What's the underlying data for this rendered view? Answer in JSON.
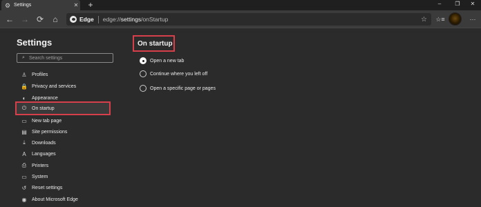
{
  "tab": {
    "title": "Settings",
    "icon": "gear-icon",
    "close_icon": "close-icon"
  },
  "tabstrip": {
    "new_tab": "+"
  },
  "window": {
    "minimize": "–",
    "restore": "❐",
    "close": "✕"
  },
  "toolbar": {
    "back": "←",
    "forward": "→",
    "refresh": "⟳",
    "home": "⌂",
    "address_label": "Edge",
    "url_prefix": "edge://",
    "url_bold": "settings",
    "url_suffix": "/onStartup",
    "favorite_icon": "☆",
    "collections_icon": "☆≡",
    "more_icon": "···"
  },
  "sidebar": {
    "title": "Settings",
    "search_placeholder": "Search settings",
    "items": [
      {
        "label": "Profiles",
        "icon": "person-icon",
        "glyph": "♙"
      },
      {
        "label": "Privacy and services",
        "icon": "lock-icon",
        "glyph": "🔒"
      },
      {
        "label": "Appearance",
        "icon": "palette-icon",
        "glyph": "◐"
      },
      {
        "label": "On startup",
        "icon": "power-icon",
        "glyph": "⏻"
      },
      {
        "label": "New tab page",
        "icon": "newtab-icon",
        "glyph": "▭"
      },
      {
        "label": "Site permissions",
        "icon": "permissions-icon",
        "glyph": "▤"
      },
      {
        "label": "Downloads",
        "icon": "download-icon",
        "glyph": "⤓"
      },
      {
        "label": "Languages",
        "icon": "language-icon",
        "glyph": "A"
      },
      {
        "label": "Printers",
        "icon": "printer-icon",
        "glyph": "⎙"
      },
      {
        "label": "System",
        "icon": "system-icon",
        "glyph": "▭"
      },
      {
        "label": "Reset settings",
        "icon": "reset-icon",
        "glyph": "↺"
      },
      {
        "label": "About Microsoft Edge",
        "icon": "edge-icon",
        "glyph": "◉"
      }
    ]
  },
  "main": {
    "title": "On startup",
    "options": [
      {
        "label": "Open a new tab",
        "checked": true
      },
      {
        "label": "Continue where you left off",
        "checked": false
      },
      {
        "label": "Open a specific page or pages",
        "checked": false
      }
    ]
  },
  "colors": {
    "highlight": "#d7404a",
    "background": "#2b2b2b",
    "toolbar": "#3b3b3b"
  }
}
